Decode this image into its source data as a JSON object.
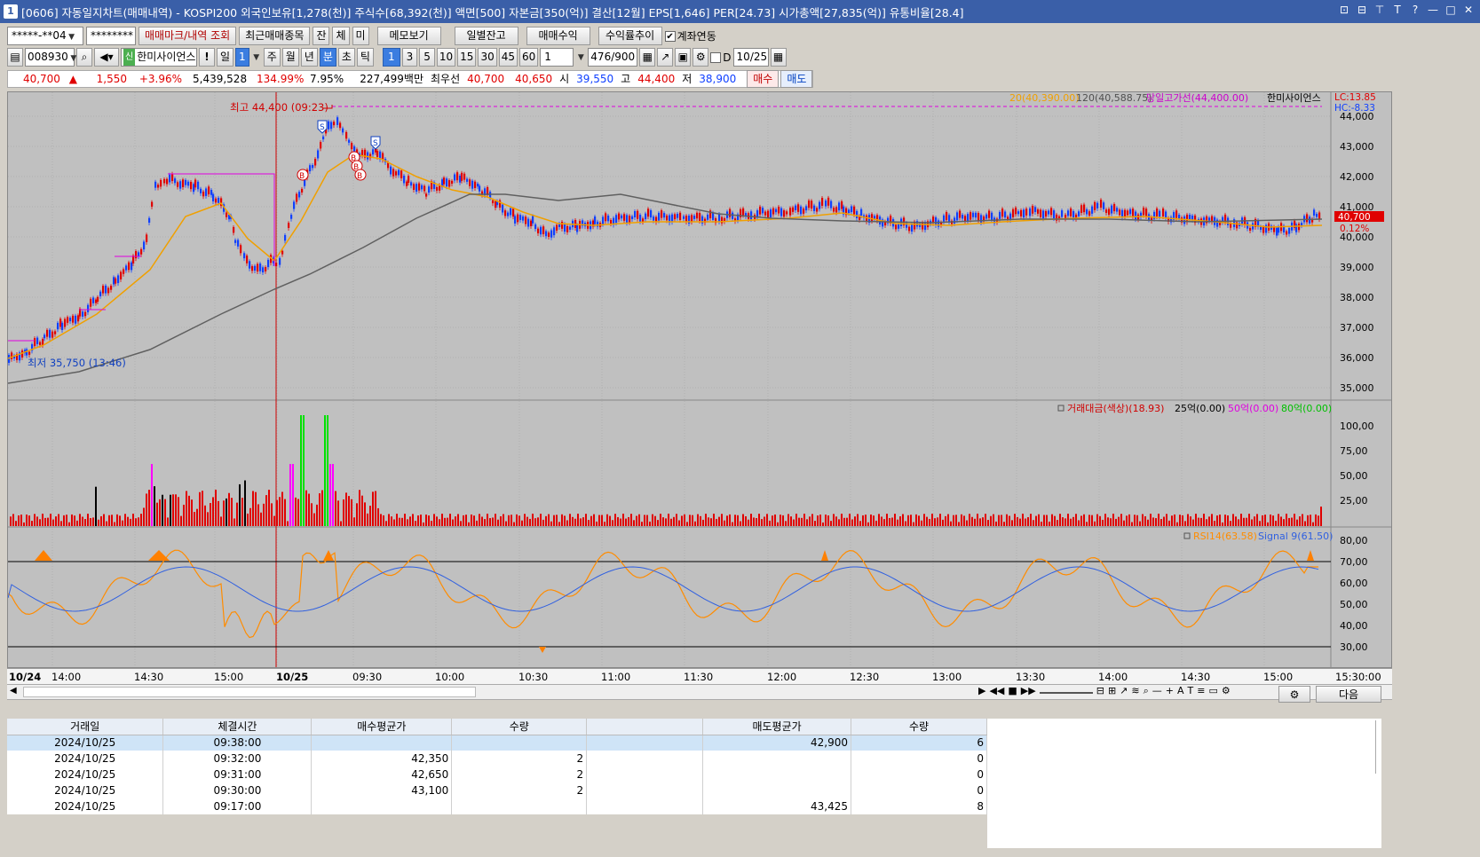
{
  "window": {
    "icon": "1",
    "title": "[0606] 자동일지차트(매매내역) - KOSPI200 외국인보유[1,278(천)] 주식수[68,392(천)] 액면[500] 자본금[350(억)] 결산[12월] EPS[1,646] PER[24.73] 시가총액[27,835(억)] 유통비율[28.4]",
    "controls": [
      "⊡",
      "⊟",
      "⊤",
      "T",
      "?",
      "—",
      "□",
      "✕"
    ]
  },
  "toolbar1": {
    "account": "*****-**04",
    "password": "********",
    "btn_trade_marks": "매매마크/내역 조회",
    "btn_recent_items": "최근매매종목",
    "btn_jan": "잔",
    "btn_che": "체",
    "btn_mi": "미",
    "btn_memo": "메모보기",
    "btn_daily_balance": "일별잔고",
    "btn_trade_profit": "매매수익",
    "btn_return_trend": "수익률추이",
    "account_link_label": "계좌연동",
    "account_link_checked": "✔"
  },
  "toolbar2": {
    "code": "008930",
    "stock_name": "한미사이언스",
    "sin": "신",
    "excl": "!",
    "periods": [
      "일",
      "1",
      "주",
      "월",
      "년",
      "분",
      "초",
      "틱"
    ],
    "selected_period": "분",
    "intervals": [
      "1",
      "3",
      "5",
      "10",
      "15",
      "30",
      "45",
      "60"
    ],
    "selected_interval": "1",
    "count_value": "1",
    "count_display": "476",
    "count_total": "/900",
    "d_label": "D",
    "date": "10/25"
  },
  "quote": {
    "price": "40,700",
    "arrow": "▲",
    "change": "1,550",
    "change_pct": "+3.96%",
    "volume": "5,439,528",
    "vol_ratio": "134.99%",
    "turnover": "7.95%",
    "amount": "227,499백만",
    "best_offer_label": "최우선",
    "best_ask": "40,700",
    "best_bid": "40,650",
    "open_label": "시",
    "open": "39,550",
    "high_label": "고",
    "high": "44,400",
    "low_label": "저",
    "low": "38,900",
    "buy_btn": "매수",
    "sell_btn": "매도"
  },
  "price_panel": {
    "legend_ma20": "20(40,390.00)",
    "legend_ma120": "120(40,588.75)",
    "legend_high_line": "당일고가선(44,400.00)",
    "legend_name": "한미사이언스",
    "lc": "LC:13.85",
    "hc": "HC:-8.33",
    "high_annot": "최고 44,400 (09:23)",
    "low_annot": "최저 35,750 (13:46)",
    "last_price": "40,700",
    "last_pct": "0.12%",
    "yticks": [
      "44,000",
      "43,000",
      "42,000",
      "41,000",
      "40,000",
      "39,000",
      "38,000",
      "37,000",
      "36,000",
      "35,000"
    ],
    "marks": [
      "S",
      "S",
      "B",
      "B",
      "B",
      "B"
    ]
  },
  "volume_panel": {
    "legend_main": "거래대금(색상)(18.93)",
    "legend_25": "25억(0.00)",
    "legend_50": "50억(0.00)",
    "legend_80": "80억(0.00)",
    "yticks": [
      "100,00",
      "75,00",
      "50,00",
      "25,00"
    ]
  },
  "rsi_panel": {
    "legend_rsi": "RSI14(63.58)",
    "legend_signal": "Signal 9(61.50)",
    "yticks": [
      "80,00",
      "70,00",
      "60,00",
      "50,00",
      "40,00",
      "30,00"
    ]
  },
  "xaxis": {
    "labels": [
      "10/24",
      "14:00",
      "14:30",
      "15:00",
      "10/25",
      "09:30",
      "10:00",
      "10:30",
      "11:00",
      "11:30",
      "12:00",
      "12:30",
      "13:00",
      "13:30",
      "14:00",
      "14:30",
      "15:00",
      "15:30:00"
    ]
  },
  "bottom": {
    "next_btn": "다음",
    "columns": [
      "거래일",
      "체결시간",
      "매수평균가",
      "수량",
      "",
      "매도평균가",
      "수량"
    ],
    "rows": [
      [
        "2024/10/25",
        "09:38:00",
        "",
        "",
        "",
        "42,900",
        "6"
      ],
      [
        "2024/10/25",
        "09:32:00",
        "42,350",
        "2",
        "",
        "",
        "0"
      ],
      [
        "2024/10/25",
        "09:31:00",
        "42,650",
        "2",
        "",
        "",
        "0"
      ],
      [
        "2024/10/25",
        "09:30:00",
        "43,100",
        "2",
        "",
        "",
        "0"
      ],
      [
        "2024/10/25",
        "09:17:00",
        "",
        "",
        "",
        "43,425",
        "8"
      ]
    ]
  },
  "colors": {
    "up": "#e00000",
    "down": "#1040ff",
    "ma20": "#f0a000",
    "ma120": "#606060",
    "rsi": "#ff8c00",
    "signal": "#3060e0",
    "panel_bg": "#c0c0c0"
  }
}
